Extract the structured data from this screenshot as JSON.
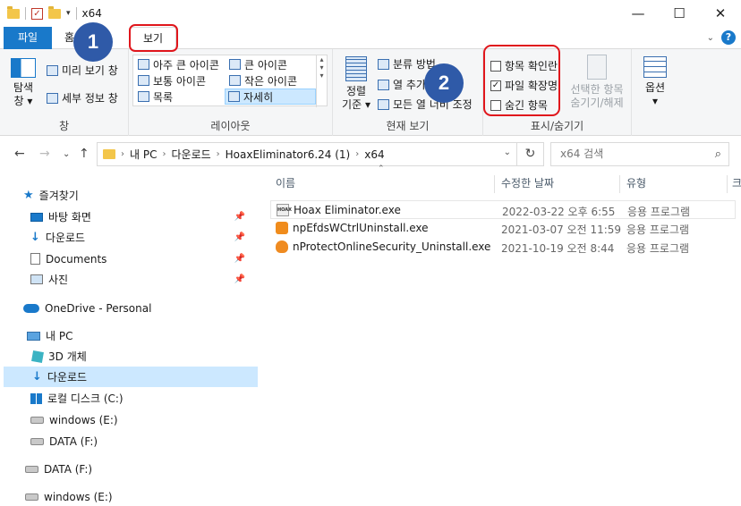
{
  "window": {
    "title": "x64",
    "min": "—",
    "max": "☐",
    "close": "✕"
  },
  "tabs": {
    "file": "파일",
    "home": "홈",
    "view": "보기"
  },
  "ribbon": {
    "pane": {
      "nav_pane": "탐색",
      "nav_pane2": "창",
      "preview": "미리 보기 창",
      "details": "세부 정보 창",
      "label": "창"
    },
    "layout": {
      "extra_large": "아주 큰 아이콘",
      "large": "큰 아이콘",
      "medium": "보통 아이콘",
      "small": "작은 아이콘",
      "list": "목록",
      "details": "자세히",
      "label": "레이아웃"
    },
    "current_view": {
      "sort": "정렬",
      "sort2": "기준",
      "group_by": "분류 방법",
      "add_columns": "열 추가",
      "fit_columns": "모든 열 너비 조정",
      "label": "현재 보기"
    },
    "show_hide": {
      "item_checkboxes": "항목 확인란",
      "file_extensions": "파일 확장명",
      "hidden_items": "숨긴 항목",
      "hide_selected": "선택한 항목",
      "hide_selected2": "숨기기/해제",
      "label": "표시/숨기기",
      "item_checkboxes_checked": false,
      "file_extensions_checked": true,
      "hidden_items_checked": false
    },
    "options": {
      "label": "옵션"
    }
  },
  "annotations": {
    "step1": "1",
    "step2": "2"
  },
  "address": {
    "segments": [
      "내 PC",
      "다운로드",
      "HoaxEliminator6.24 (1)",
      "x64"
    ],
    "search_placeholder": "x64 검색"
  },
  "sidebar": {
    "quick_access": "즐겨찾기",
    "items": [
      {
        "label": "바탕 화면",
        "pinned": true
      },
      {
        "label": "다운로드",
        "pinned": true
      },
      {
        "label": "Documents",
        "pinned": true
      },
      {
        "label": "사진",
        "pinned": true
      }
    ],
    "onedrive": "OneDrive - Personal",
    "this_pc": "내 PC",
    "pc_items": [
      "3D 개체",
      "다운로드",
      "로컬 디스크 (C:)",
      "windows (E:)",
      "DATA (F:)"
    ],
    "drives": [
      "DATA (F:)",
      "windows (E:)"
    ]
  },
  "list": {
    "columns": {
      "name": "이름",
      "date": "수정한 날짜",
      "type": "유형",
      "size": "크"
    },
    "rows": [
      {
        "name": "Hoax Eliminator.exe",
        "date": "2022-03-22 오후 6:55",
        "type": "응용 프로그램"
      },
      {
        "name": "npEfdsWCtrlUninstall.exe",
        "date": "2021-03-07 오전 11:59",
        "type": "응용 프로그램"
      },
      {
        "name": "nProtectOnlineSecurity_Uninstall.exe",
        "date": "2021-10-19 오전 8:44",
        "type": "응용 프로그램"
      }
    ]
  },
  "colors": {
    "accent": "#1979ca",
    "highlight": "#e0161c",
    "step_badge": "#2f5aa8",
    "selection": "#cce8ff"
  }
}
